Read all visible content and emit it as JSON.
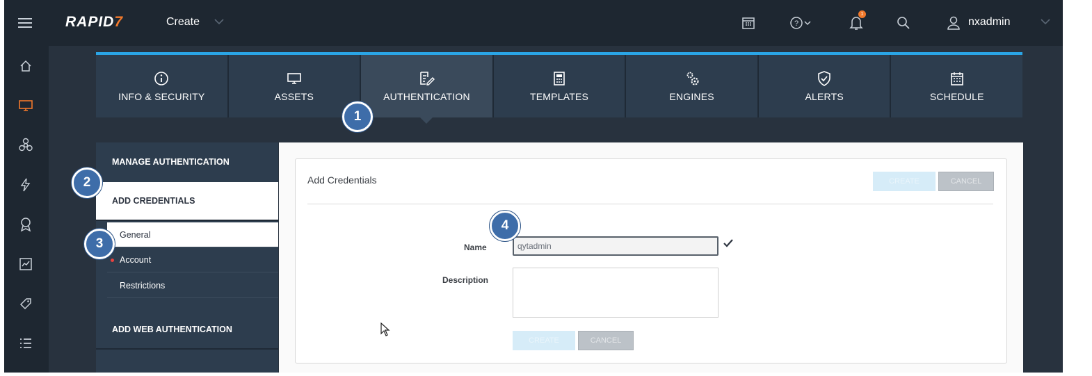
{
  "header": {
    "logo_main": "RAPID",
    "logo_accent": "7",
    "create_label": "Create",
    "username": "nxadmin",
    "notification_count": "1",
    "icons": [
      "menu-icon",
      "calendar-icon",
      "help-icon",
      "bell-icon",
      "search-icon",
      "user-icon",
      "chevron-down-icon"
    ]
  },
  "left_nav": {
    "icons": [
      "home-icon",
      "assets-icon",
      "vulnerabilities-icon",
      "exploits-icon",
      "policies-icon",
      "reports-icon",
      "tags-icon",
      "list-icon"
    ]
  },
  "tabs": [
    {
      "label": "INFO & SECURITY",
      "icon": "info-icon"
    },
    {
      "label": "ASSETS",
      "icon": "monitor-icon"
    },
    {
      "label": "AUTHENTICATION",
      "icon": "edit-doc-icon"
    },
    {
      "label": "TEMPLATES",
      "icon": "calculator-icon"
    },
    {
      "label": "ENGINES",
      "icon": "gears-icon"
    },
    {
      "label": "ALERTS",
      "icon": "shield-check-icon"
    },
    {
      "label": "SCHEDULE",
      "icon": "calendar-icon"
    }
  ],
  "side_menu": {
    "manage_auth": "MANAGE AUTHENTICATION",
    "add_credentials": "ADD CREDENTIALS",
    "sub_items": [
      "General",
      "Account",
      "Restrictions"
    ],
    "add_web_auth": "ADD WEB AUTHENTICATION"
  },
  "form": {
    "title": "Add Credentials",
    "save_label": "CREATE",
    "cancel_label": "CANCEL",
    "name_label": "Name",
    "name_value": "qytadmin",
    "description_label": "Description",
    "description_value": ""
  },
  "steps": [
    "1",
    "2",
    "3",
    "4"
  ],
  "colors": {
    "accent_blue": "#2aa5e6",
    "step_blue": "#3e6da9",
    "logo_orange": "#f2792b",
    "required_red": "#e8423f"
  }
}
